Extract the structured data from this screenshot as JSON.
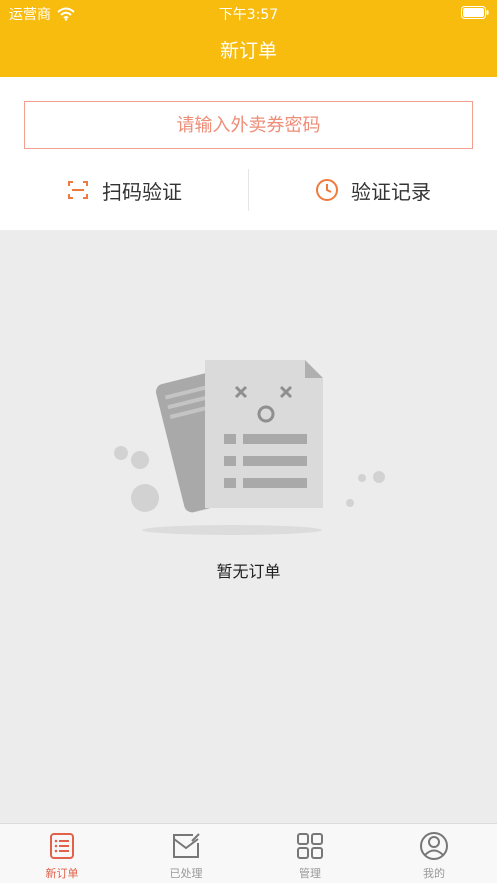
{
  "status_bar": {
    "carrier": "运营商",
    "time": "下午3:57"
  },
  "nav": {
    "title": "新订单"
  },
  "voucher": {
    "placeholder": "请输入外卖券密码"
  },
  "actions": {
    "scan_label": "扫码验证",
    "history_label": "验证记录"
  },
  "empty_state": {
    "message": "暂无订单"
  },
  "tabbar": {
    "items": [
      {
        "label": "新订单",
        "icon": "order-list-icon",
        "active": true
      },
      {
        "label": "已处理",
        "icon": "processed-mail-icon",
        "active": false
      },
      {
        "label": "管理",
        "icon": "grid-manage-icon",
        "active": false
      },
      {
        "label": "我的",
        "icon": "profile-icon",
        "active": false
      }
    ]
  },
  "colors": {
    "header": "#f7bc0e",
    "accent": "#e2614b",
    "input_border": "#f0a08e",
    "icon_orange": "#ef7a3d",
    "background": "#ececec"
  }
}
